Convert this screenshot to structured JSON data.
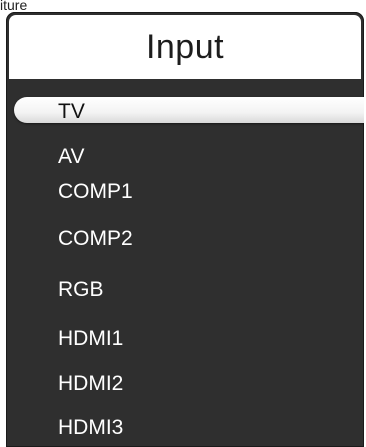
{
  "cropped_top_text": "iture",
  "menu": {
    "title": "Input",
    "items": [
      {
        "label": "TV",
        "selected": true
      },
      {
        "label": "AV",
        "selected": false
      },
      {
        "label": "COMP1",
        "selected": false
      },
      {
        "label": "COMP2",
        "selected": false
      },
      {
        "label": "RGB",
        "selected": false
      },
      {
        "label": "HDMI1",
        "selected": false
      },
      {
        "label": "HDMI2",
        "selected": false
      },
      {
        "label": "HDMI3",
        "selected": false
      }
    ]
  },
  "colors": {
    "panel_background": "#2f2f2f",
    "title_background": "#ffffff",
    "item_text": "#ffffff",
    "selected_text": "#111111"
  }
}
